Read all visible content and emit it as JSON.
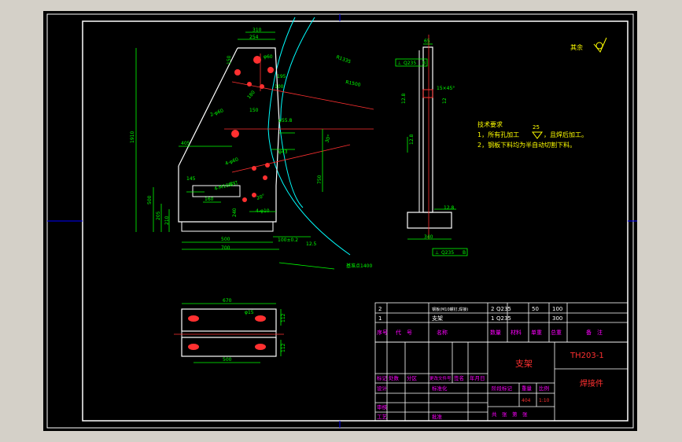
{
  "colors": {
    "background": "#000000",
    "frame": "#ffffff",
    "part": "#ffffff",
    "dimension": "#00ff00",
    "center": "#ff0000",
    "arc": "#00ffff",
    "hole": "#ff0000",
    "table_text": "#ff00ff",
    "title_text": "#ff0000"
  },
  "front_view": {
    "dims": [
      "310",
      "254",
      "150",
      "φ60",
      "R1335",
      "R1500",
      "195",
      "100",
      "180",
      "150",
      "2-φ60",
      "405",
      "1910",
      "φ55.8",
      "φ43",
      "30°",
      "750",
      "4-φ60",
      "4-M10螺钉",
      "145",
      "160",
      "500",
      "205",
      "210",
      "240",
      "500",
      "700",
      "100±0.2",
      "12.5"
    ],
    "note_inner": "φ55.8",
    "note_arc": "基准点1400",
    "note_20": "20°",
    "note_240": "4-φ10"
  },
  "side_view": {
    "dims": [
      "65",
      "Q235",
      "Q235",
      "12.8",
      "15×45°",
      "12",
      "12.8",
      "340",
      "12.8",
      "2",
      "Q235"
    ],
    "gdt_top": [
      "⊥",
      "Q235",
      "B"
    ],
    "gdt_bottom": [
      "⊥",
      "Q235",
      "B"
    ]
  },
  "roughness_note": "其余",
  "tech_requirements": {
    "title": "技术要求",
    "roughness_value": "25",
    "items": [
      "1，所有孔加工",
      "，且焊后加工。",
      "2，钢板下料均为半自动切割下料。"
    ]
  },
  "bottom_view": {
    "dims": [
      "670",
      "φ15",
      "112",
      "500",
      "112"
    ]
  },
  "bom": {
    "rows": [
      {
        "seq": "2",
        "code": "",
        "name": "钢板(M10螺钉,焊接)",
        "qty": "2",
        "material": "Q235",
        "unit_weight": "50",
        "total_weight": "100",
        "remark": ""
      },
      {
        "seq": "1",
        "code": "",
        "name": "支架",
        "qty": "1",
        "material": "Q235",
        "unit_weight": "",
        "total_weight": "300",
        "remark": ""
      }
    ],
    "headers": [
      "序号",
      "代　号",
      "名称",
      "数量",
      "材料",
      "单重",
      "总重",
      "备　注"
    ]
  },
  "title_block": {
    "part_name": "支架",
    "drawing_no": "TH203-1",
    "type": "焊接件",
    "revision_labels": [
      "标记",
      "处数",
      "分区",
      "更改文件号",
      "签名",
      "年月日"
    ],
    "signoff_labels": [
      "设计",
      "审核",
      "工艺",
      "批准"
    ],
    "standardization": "标准化",
    "stage_labels": [
      "阶段标记",
      "重量",
      "比例"
    ],
    "weight": "404",
    "scale": "1:10",
    "sheet_info": "共　张　第　张"
  }
}
